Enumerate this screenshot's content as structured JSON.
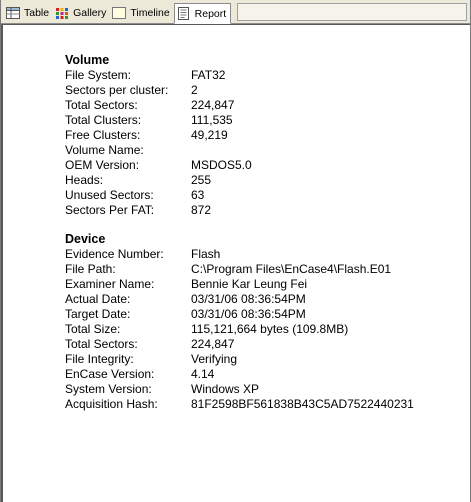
{
  "tabs": [
    {
      "label": "Table",
      "icon": "table-icon"
    },
    {
      "label": "Gallery",
      "icon": "gallery-icon"
    },
    {
      "label": "Timeline",
      "icon": "timeline-icon"
    },
    {
      "label": "Report",
      "icon": "report-icon"
    }
  ],
  "active_tab": "Report",
  "volume": {
    "title": "Volume",
    "rows": [
      {
        "label": "File System:",
        "value": "FAT32"
      },
      {
        "label": "Sectors per cluster:",
        "value": "2"
      },
      {
        "label": "Total Sectors:",
        "value": "224,847"
      },
      {
        "label": "Total Clusters:",
        "value": "111,535"
      },
      {
        "label": "Free Clusters:",
        "value": "49,219"
      },
      {
        "label": "Volume Name:",
        "value": ""
      },
      {
        "label": "OEM Version:",
        "value": "MSDOS5.0"
      },
      {
        "label": "Heads:",
        "value": "255"
      },
      {
        "label": "Unused Sectors:",
        "value": "63"
      },
      {
        "label": "Sectors Per FAT:",
        "value": "872"
      }
    ]
  },
  "device": {
    "title": "Device",
    "rows": [
      {
        "label": "Evidence Number:",
        "value": "Flash"
      },
      {
        "label": "File Path:",
        "value": "C:\\Program Files\\EnCase4\\Flash.E01"
      },
      {
        "label": "Examiner Name:",
        "value": "Bennie Kar Leung Fei"
      },
      {
        "label": "Actual Date:",
        "value": "03/31/06 08:36:54PM"
      },
      {
        "label": "Target Date:",
        "value": "03/31/06 08:36:54PM"
      },
      {
        "label": "Total Size:",
        "value": "115,121,664 bytes (109.8MB)"
      },
      {
        "label": "Total Sectors:",
        "value": "224,847"
      },
      {
        "label": "File Integrity:",
        "value": "Verifying"
      },
      {
        "label": "EnCase Version:",
        "value": "4.14"
      },
      {
        "label": "System Version:",
        "value": "Windows XP"
      },
      {
        "label": "Acquisition Hash:",
        "value": "81F2598BF561838B43C5AD7522440231"
      }
    ]
  }
}
